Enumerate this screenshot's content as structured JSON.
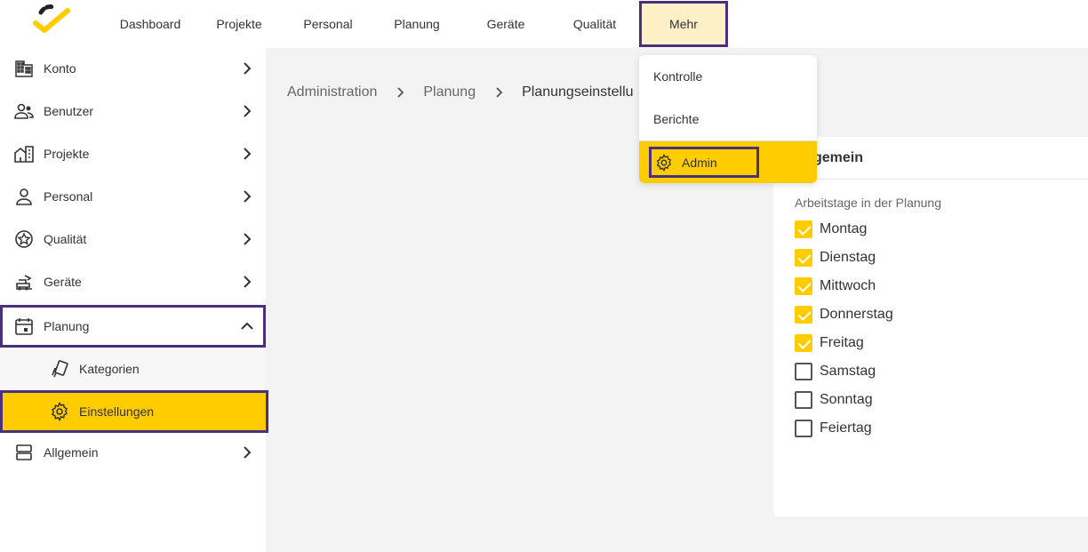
{
  "colors": {
    "accent": "#ffcc00",
    "highlight_outline": "#4a2f7a",
    "active_nav_bg": "#fdf0c6"
  },
  "topnav": {
    "items": [
      {
        "label": "Dashboard"
      },
      {
        "label": "Projekte"
      },
      {
        "label": "Personal"
      },
      {
        "label": "Planung"
      },
      {
        "label": "Geräte"
      },
      {
        "label": "Qualität"
      },
      {
        "label": "Mehr",
        "active": true
      }
    ]
  },
  "dropdown": {
    "items": [
      {
        "label": "Kontrolle"
      },
      {
        "label": "Berichte"
      }
    ],
    "admin": {
      "label": "Admin",
      "icon": "gear-icon"
    }
  },
  "sidebar": {
    "items": [
      {
        "label": "Konto",
        "icon": "building-icon"
      },
      {
        "label": "Benutzer",
        "icon": "users-icon"
      },
      {
        "label": "Projekte",
        "icon": "projects-icon"
      },
      {
        "label": "Personal",
        "icon": "person-icon"
      },
      {
        "label": "Qualität",
        "icon": "star-badge-icon"
      },
      {
        "label": "Geräte",
        "icon": "equipment-icon"
      },
      {
        "label": "Planung",
        "icon": "calendar-icon",
        "expanded": true
      },
      {
        "label": "Kategorien",
        "icon": "cards-icon",
        "sub": true
      },
      {
        "label": "Einstellungen",
        "icon": "gear-icon",
        "sub": true,
        "selected": true
      },
      {
        "label": "Allgemein",
        "icon": "layers-icon"
      }
    ]
  },
  "breadcrumb": {
    "items": [
      "Administration",
      "Planung"
    ],
    "current": "Planungseinstellu"
  },
  "card": {
    "title": "gemein",
    "subtitle": "Arbeitstage in der Planung",
    "days": [
      {
        "label": "Montag",
        "checked": true
      },
      {
        "label": "Dienstag",
        "checked": true
      },
      {
        "label": "Mittwoch",
        "checked": true
      },
      {
        "label": "Donnerstag",
        "checked": true
      },
      {
        "label": "Freitag",
        "checked": true
      },
      {
        "label": "Samstag",
        "checked": false
      },
      {
        "label": "Sonntag",
        "checked": false
      },
      {
        "label": "Feiertag",
        "checked": false
      }
    ]
  }
}
